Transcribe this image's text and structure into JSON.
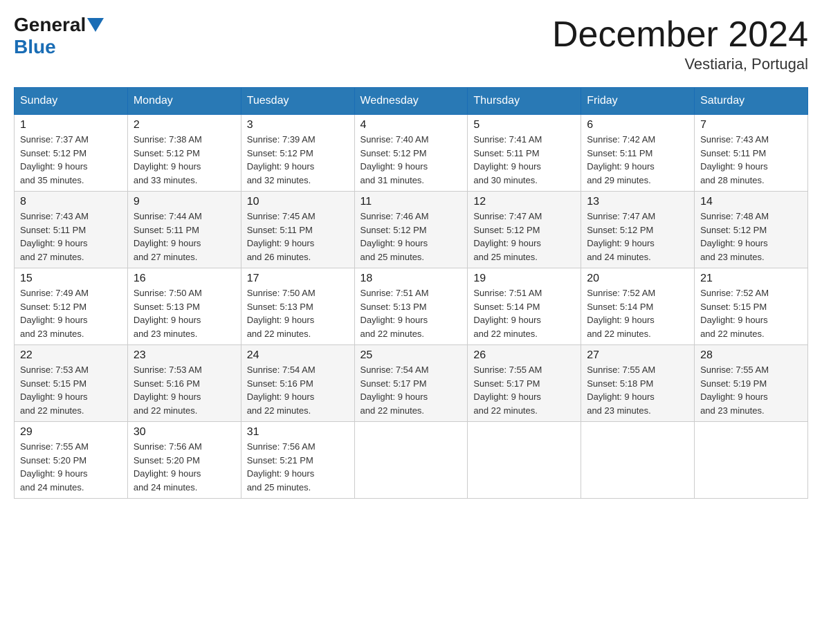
{
  "header": {
    "logo_text_general": "General",
    "logo_text_blue": "Blue",
    "month_title": "December 2024",
    "location": "Vestiaria, Portugal"
  },
  "days_of_week": [
    "Sunday",
    "Monday",
    "Tuesday",
    "Wednesday",
    "Thursday",
    "Friday",
    "Saturday"
  ],
  "weeks": [
    [
      {
        "day": "1",
        "sunrise": "7:37 AM",
        "sunset": "5:12 PM",
        "daylight": "9 hours and 35 minutes."
      },
      {
        "day": "2",
        "sunrise": "7:38 AM",
        "sunset": "5:12 PM",
        "daylight": "9 hours and 33 minutes."
      },
      {
        "day": "3",
        "sunrise": "7:39 AM",
        "sunset": "5:12 PM",
        "daylight": "9 hours and 32 minutes."
      },
      {
        "day": "4",
        "sunrise": "7:40 AM",
        "sunset": "5:12 PM",
        "daylight": "9 hours and 31 minutes."
      },
      {
        "day": "5",
        "sunrise": "7:41 AM",
        "sunset": "5:11 PM",
        "daylight": "9 hours and 30 minutes."
      },
      {
        "day": "6",
        "sunrise": "7:42 AM",
        "sunset": "5:11 PM",
        "daylight": "9 hours and 29 minutes."
      },
      {
        "day": "7",
        "sunrise": "7:43 AM",
        "sunset": "5:11 PM",
        "daylight": "9 hours and 28 minutes."
      }
    ],
    [
      {
        "day": "8",
        "sunrise": "7:43 AM",
        "sunset": "5:11 PM",
        "daylight": "9 hours and 27 minutes."
      },
      {
        "day": "9",
        "sunrise": "7:44 AM",
        "sunset": "5:11 PM",
        "daylight": "9 hours and 27 minutes."
      },
      {
        "day": "10",
        "sunrise": "7:45 AM",
        "sunset": "5:11 PM",
        "daylight": "9 hours and 26 minutes."
      },
      {
        "day": "11",
        "sunrise": "7:46 AM",
        "sunset": "5:12 PM",
        "daylight": "9 hours and 25 minutes."
      },
      {
        "day": "12",
        "sunrise": "7:47 AM",
        "sunset": "5:12 PM",
        "daylight": "9 hours and 25 minutes."
      },
      {
        "day": "13",
        "sunrise": "7:47 AM",
        "sunset": "5:12 PM",
        "daylight": "9 hours and 24 minutes."
      },
      {
        "day": "14",
        "sunrise": "7:48 AM",
        "sunset": "5:12 PM",
        "daylight": "9 hours and 23 minutes."
      }
    ],
    [
      {
        "day": "15",
        "sunrise": "7:49 AM",
        "sunset": "5:12 PM",
        "daylight": "9 hours and 23 minutes."
      },
      {
        "day": "16",
        "sunrise": "7:50 AM",
        "sunset": "5:13 PM",
        "daylight": "9 hours and 23 minutes."
      },
      {
        "day": "17",
        "sunrise": "7:50 AM",
        "sunset": "5:13 PM",
        "daylight": "9 hours and 22 minutes."
      },
      {
        "day": "18",
        "sunrise": "7:51 AM",
        "sunset": "5:13 PM",
        "daylight": "9 hours and 22 minutes."
      },
      {
        "day": "19",
        "sunrise": "7:51 AM",
        "sunset": "5:14 PM",
        "daylight": "9 hours and 22 minutes."
      },
      {
        "day": "20",
        "sunrise": "7:52 AM",
        "sunset": "5:14 PM",
        "daylight": "9 hours and 22 minutes."
      },
      {
        "day": "21",
        "sunrise": "7:52 AM",
        "sunset": "5:15 PM",
        "daylight": "9 hours and 22 minutes."
      }
    ],
    [
      {
        "day": "22",
        "sunrise": "7:53 AM",
        "sunset": "5:15 PM",
        "daylight": "9 hours and 22 minutes."
      },
      {
        "day": "23",
        "sunrise": "7:53 AM",
        "sunset": "5:16 PM",
        "daylight": "9 hours and 22 minutes."
      },
      {
        "day": "24",
        "sunrise": "7:54 AM",
        "sunset": "5:16 PM",
        "daylight": "9 hours and 22 minutes."
      },
      {
        "day": "25",
        "sunrise": "7:54 AM",
        "sunset": "5:17 PM",
        "daylight": "9 hours and 22 minutes."
      },
      {
        "day": "26",
        "sunrise": "7:55 AM",
        "sunset": "5:17 PM",
        "daylight": "9 hours and 22 minutes."
      },
      {
        "day": "27",
        "sunrise": "7:55 AM",
        "sunset": "5:18 PM",
        "daylight": "9 hours and 23 minutes."
      },
      {
        "day": "28",
        "sunrise": "7:55 AM",
        "sunset": "5:19 PM",
        "daylight": "9 hours and 23 minutes."
      }
    ],
    [
      {
        "day": "29",
        "sunrise": "7:55 AM",
        "sunset": "5:20 PM",
        "daylight": "9 hours and 24 minutes."
      },
      {
        "day": "30",
        "sunrise": "7:56 AM",
        "sunset": "5:20 PM",
        "daylight": "9 hours and 24 minutes."
      },
      {
        "day": "31",
        "sunrise": "7:56 AM",
        "sunset": "5:21 PM",
        "daylight": "9 hours and 25 minutes."
      },
      null,
      null,
      null,
      null
    ]
  ],
  "labels": {
    "sunrise": "Sunrise:",
    "sunset": "Sunset:",
    "daylight": "Daylight:"
  }
}
